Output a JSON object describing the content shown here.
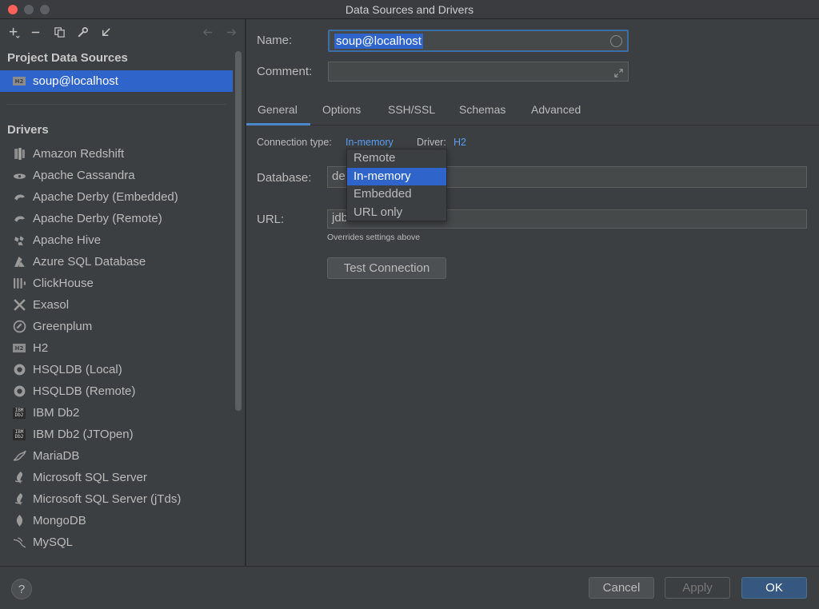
{
  "window": {
    "title": "Data Sources and Drivers"
  },
  "toolbar": {
    "add_icon": "plus-dropdown-icon",
    "remove_icon": "minus-icon",
    "copy_icon": "duplicate-icon",
    "properties_icon": "wrench-icon",
    "import_icon": "import-arrow-icon",
    "back_icon": "arrow-left-icon",
    "forward_icon": "arrow-right-icon"
  },
  "sidebar": {
    "project_title": "Project Data Sources",
    "project_items": [
      {
        "label": "soup@localhost",
        "icon": "h2-icon"
      }
    ],
    "drivers_title": "Drivers",
    "drivers": [
      {
        "label": "Amazon Redshift",
        "icon": "redshift-icon"
      },
      {
        "label": "Apache Cassandra",
        "icon": "cassandra-icon"
      },
      {
        "label": "Apache Derby (Embedded)",
        "icon": "derby-icon"
      },
      {
        "label": "Apache Derby (Remote)",
        "icon": "derby-icon"
      },
      {
        "label": "Apache Hive",
        "icon": "hive-icon"
      },
      {
        "label": "Azure SQL Database",
        "icon": "azure-icon"
      },
      {
        "label": "ClickHouse",
        "icon": "clickhouse-icon"
      },
      {
        "label": "Exasol",
        "icon": "exasol-icon"
      },
      {
        "label": "Greenplum",
        "icon": "greenplum-icon"
      },
      {
        "label": "H2",
        "icon": "h2-icon"
      },
      {
        "label": "HSQLDB (Local)",
        "icon": "hsqldb-icon"
      },
      {
        "label": "HSQLDB (Remote)",
        "icon": "hsqldb-icon"
      },
      {
        "label": "IBM Db2",
        "icon": "ibm-db2-icon"
      },
      {
        "label": "IBM Db2 (JTOpen)",
        "icon": "ibm-db2-icon"
      },
      {
        "label": "MariaDB",
        "icon": "mariadb-icon"
      },
      {
        "label": "Microsoft SQL Server",
        "icon": "sqlserver-icon"
      },
      {
        "label": "Microsoft SQL Server (jTds)",
        "icon": "sqlserver-icon"
      },
      {
        "label": "MongoDB",
        "icon": "mongodb-icon"
      },
      {
        "label": "MySQL",
        "icon": "mysql-icon"
      }
    ]
  },
  "form": {
    "name_label": "Name:",
    "name_value": "soup@localhost",
    "comment_label": "Comment:",
    "comment_value": "",
    "tabs": [
      {
        "label": "General",
        "active": true
      },
      {
        "label": "Options"
      },
      {
        "label": "SSH/SSL"
      },
      {
        "label": "Schemas"
      },
      {
        "label": "Advanced"
      }
    ],
    "connection_type_label": "Connection type:",
    "connection_type_value": "In-memory",
    "driver_label": "Driver:",
    "driver_value": "H2",
    "database_label": "Database:",
    "database_value": "de",
    "url_label": "URL:",
    "url_value": "jdbc:h2:mem:default",
    "url_hint": "Overrides settings above",
    "test_button": "Test Connection"
  },
  "connection_type_options": [
    "Remote",
    "In-memory",
    "Embedded",
    "URL only"
  ],
  "connection_type_selected": "In-memory",
  "footer": {
    "help": "?",
    "cancel": "Cancel",
    "apply": "Apply",
    "ok": "OK"
  },
  "colors": {
    "accent": "#2f65ca",
    "link": "#589df6",
    "background": "#3c3f41",
    "ok_button": "#365880"
  }
}
